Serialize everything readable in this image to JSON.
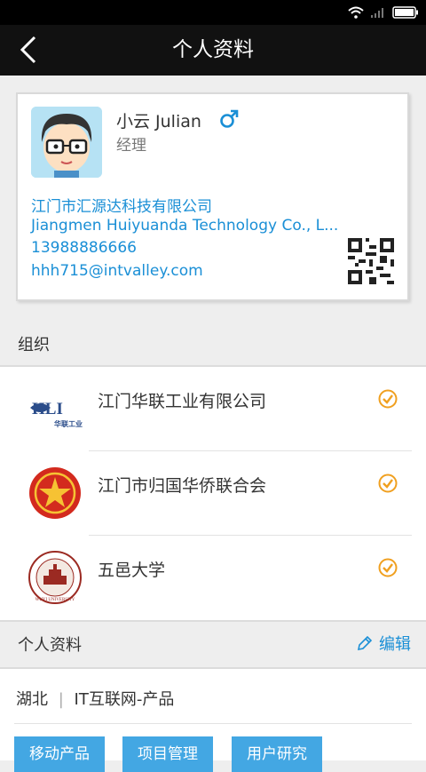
{
  "header": {
    "title": "个人资料"
  },
  "card": {
    "name": "小云 Julian",
    "job_title": "经理",
    "company_cn": "江门市汇源达科技有限公司",
    "company_en": "Jiangmen Huiyuanda Technology Co., L...",
    "phone": "13988886666",
    "email": "hhh715@intvalley.com"
  },
  "organizations": {
    "section_label": "组织",
    "items": [
      {
        "name": "江门华联工业有限公司",
        "logo_text": "HLI",
        "logo_sub": "华联工业"
      },
      {
        "name": "江门市归国华侨联合会"
      },
      {
        "name": "五邑大学",
        "logo_text": "WUYI UNIVERSITY"
      }
    ]
  },
  "profile": {
    "section_label": "个人资料",
    "edit_label": "编辑",
    "region": "湖北",
    "industry": "IT互联网-产品",
    "tags": [
      "移动产品",
      "项目管理",
      "用户研究"
    ]
  },
  "colors": {
    "accent": "#1a8fd6",
    "tag_bg": "#43a7e3",
    "check": "#f0a020",
    "header": "#111111"
  }
}
